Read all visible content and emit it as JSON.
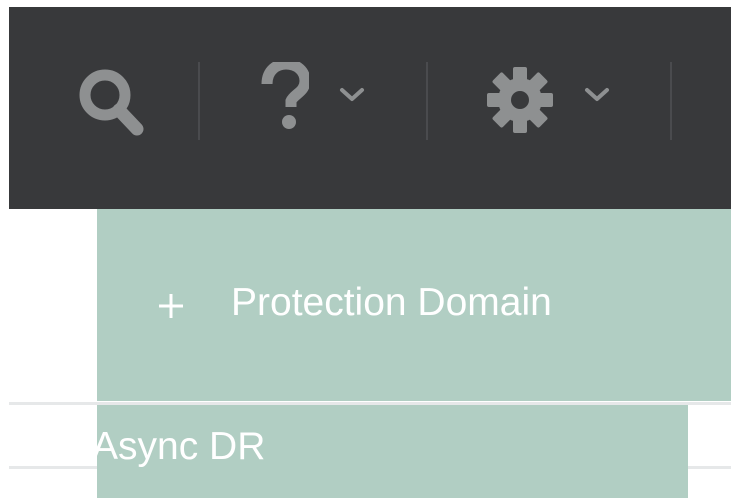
{
  "topbar": {
    "icons": {
      "search": "search-icon",
      "help": "question-icon",
      "settings": "gear-icon",
      "chevron": "chevron-down-icon"
    }
  },
  "menu": {
    "create_label": "Protection Domain",
    "create_icon": "plus-icon",
    "submenu_item": "Async DR"
  },
  "colors": {
    "topbar_bg": "#38393b",
    "icon_gray": "#8e9091",
    "menu_bg": "#b1cec3",
    "menu_text": "#ffffff"
  }
}
